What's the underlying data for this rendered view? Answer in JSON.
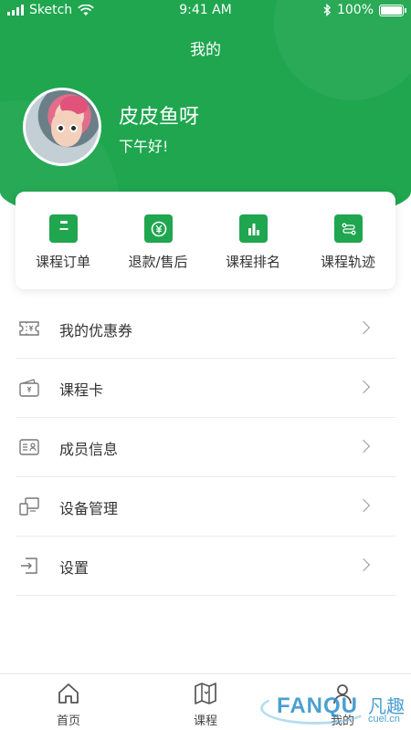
{
  "status_bar": {
    "carrier": "Sketch",
    "time": "9:41 AM",
    "battery": "100%"
  },
  "header": {
    "title": "我的"
  },
  "profile": {
    "name": "皮皮鱼呀",
    "greeting": "下午好!"
  },
  "quick_actions": [
    {
      "label": "课程订单",
      "icon": "clipboard-icon"
    },
    {
      "label": "退款/售后",
      "icon": "yuan-refund-icon"
    },
    {
      "label": "课程排名",
      "icon": "bar-chart-icon"
    },
    {
      "label": "课程轨迹",
      "icon": "route-icon"
    }
  ],
  "menu": [
    {
      "label": "我的优惠券",
      "icon": "coupon-icon"
    },
    {
      "label": "课程卡",
      "icon": "wallet-card-icon"
    },
    {
      "label": "成员信息",
      "icon": "id-card-icon"
    },
    {
      "label": "设备管理",
      "icon": "devices-icon"
    },
    {
      "label": "设置",
      "icon": "exit-settings-icon"
    }
  ],
  "tabbar": [
    {
      "label": "首页",
      "icon": "home-icon"
    },
    {
      "label": "课程",
      "icon": "map-icon"
    },
    {
      "label": "我的",
      "icon": "user-icon",
      "active": true
    }
  ],
  "watermark": {
    "brand": "FANQU",
    "cn": "凡趣",
    "url": "cuel.cn"
  },
  "colors": {
    "primary": "#1fa64f",
    "text": "#333333",
    "divider": "#ececec"
  }
}
